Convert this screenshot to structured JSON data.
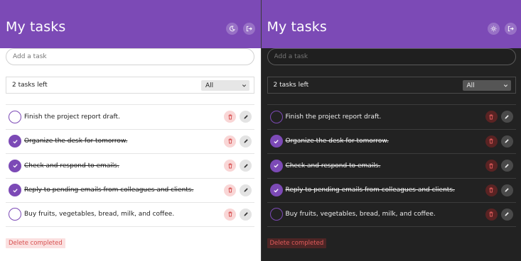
{
  "app": {
    "title": "My tasks"
  },
  "add_task": {
    "placeholder": "Add a task"
  },
  "status": {
    "tasks_left": "2 tasks left"
  },
  "filter": {
    "selected": "All"
  },
  "tasks": [
    {
      "text": "Finish the project report draft.",
      "completed": false
    },
    {
      "text": "Organize the desk for tomorrow.",
      "completed": true
    },
    {
      "text": "Check and respond to emails.",
      "completed": true
    },
    {
      "text": "Reply to pending emails from colleagues and clients.",
      "completed": true
    },
    {
      "text": "Buy fruits, vegetables, bread, milk, and coffee.",
      "completed": false
    }
  ],
  "actions": {
    "delete_completed": "Delete completed"
  },
  "icons": {
    "light_theme_toggle": "moon-icon",
    "dark_theme_toggle": "sun-icon",
    "logout": "logout-icon",
    "delete": "trash-icon",
    "edit": "pencil-icon",
    "check": "check-icon",
    "dropdown": "chevron-down-icon"
  },
  "colors": {
    "accent": "#7c4ab6",
    "danger": "#d65050",
    "dark_bg": "#222222"
  }
}
